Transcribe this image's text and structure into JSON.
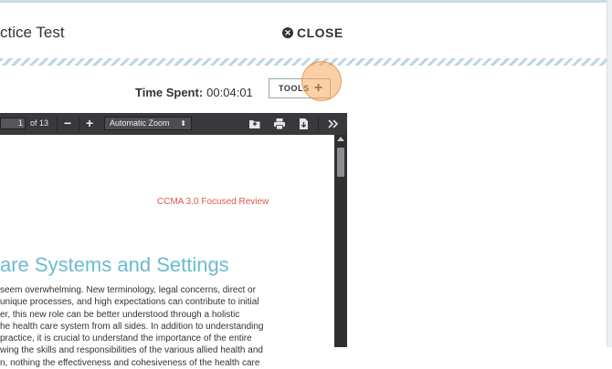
{
  "header": {
    "title": "ctice Test",
    "close_label": "CLOSE"
  },
  "status": {
    "time_spent_label": "Time Spent:",
    "time_spent_value": "00:04:01"
  },
  "tools_button": {
    "label": "TOOLS",
    "icon": "plus-icon"
  },
  "pdf_viewer": {
    "page_number": "1",
    "page_count": "of 13",
    "zoom_out_icon": "−",
    "zoom_in_icon": "+",
    "zoom_value": "Automatic Zoom",
    "toolbar_icons": [
      "open-file-icon",
      "print-icon",
      "download-icon",
      "tools-menu-icon"
    ]
  },
  "document": {
    "running_header": "CCMA 3.0 Focused Review",
    "section_heading": "are Systems and Settings",
    "paragraph_lines": [
      "seem overwhelming. New terminology, legal concerns, direct or",
      "unique processes, and high expectations can contribute to initial",
      "er, this new role can be better understood through a holistic",
      "he health care system from all sides. In addition to understanding",
      "practice, it is crucial to understand the importance of the entire",
      "wing the skills and responsibilities of the various allied health and",
      "n, nothing the effectiveness and cohesiveness of the health care"
    ]
  },
  "colors": {
    "accent_heading": "#6bbbd1",
    "running_header": "#d95b4a",
    "toolbar_bg": "#38393c",
    "cursor_highlight": "#f8aa5f"
  }
}
